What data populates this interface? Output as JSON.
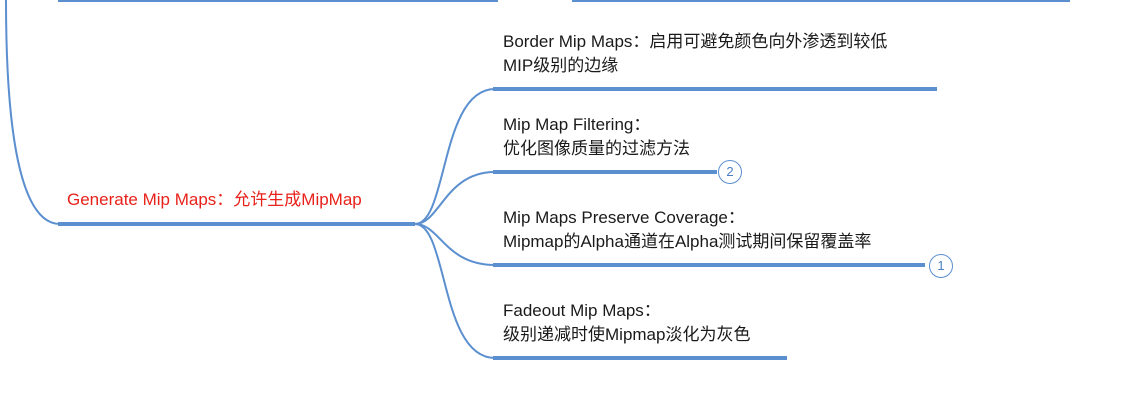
{
  "colors": {
    "branch": "#5b8fcf",
    "underline": "#5b8fcf",
    "root_text": "#e8211a",
    "text": "#1a1a1a"
  },
  "root": {
    "text": "Generate Mip Maps：允许生成MipMap"
  },
  "children": [
    {
      "line1": "Border Mip Maps：启用可避免颜色向外渗透到较低",
      "line2": "MIP级别的边缘"
    },
    {
      "line1": "Mip Map Filtering：",
      "line2": "优化图像质量的过滤方法",
      "badge": "2"
    },
    {
      "line1": "Mip Maps Preserve Coverage：",
      "line2": "Mipmap的Alpha通道在Alpha测试期间保留覆盖率",
      "badge": "1"
    },
    {
      "line1": "Fadeout Mip Maps：",
      "line2": "级别递减时使Mipmap淡化为灰色"
    }
  ]
}
